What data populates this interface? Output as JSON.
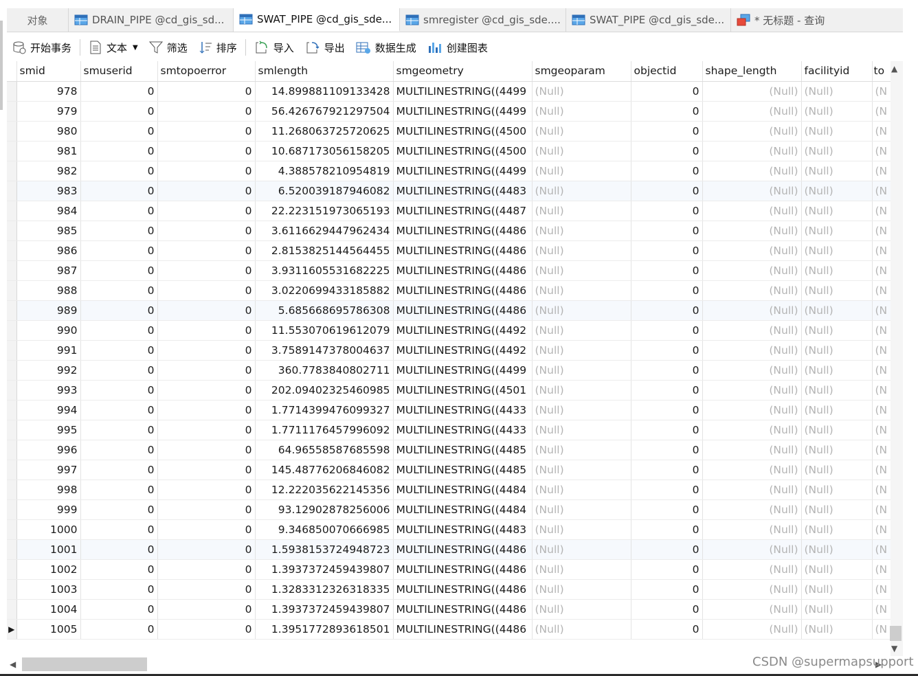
{
  "tabs": [
    {
      "label": "对象"
    },
    {
      "label": "DRAIN_PIPE @cd_gis_sd..."
    },
    {
      "label": "SWAT_PIPE @cd_gis_sde..."
    },
    {
      "label": "smregister @cd_gis_sde...."
    },
    {
      "label": "SWAT_PIPE @cd_gis_sde..."
    },
    {
      "label": "* 无标题 - 查询"
    }
  ],
  "toolbar": {
    "begin_transaction": "开始事务",
    "text": "文本",
    "filter": "筛选",
    "sort": "排序",
    "import": "导入",
    "export": "导出",
    "generate_data": "数据生成",
    "create_chart": "创建图表"
  },
  "columns": [
    "smid",
    "smuserid",
    "smtopoerror",
    "smlength",
    "smgeometry",
    "smgeoparam",
    "objectid",
    "shape_length",
    "facilityid",
    "to"
  ],
  "null_text": "(Null)",
  "null_cut": "(N",
  "rows": [
    {
      "smid": "978",
      "smuserid": "0",
      "smtopoerror": "0",
      "smlength": "14.899881109133428",
      "smgeometry": "MULTILINESTRING((4499",
      "objectid": "0"
    },
    {
      "smid": "979",
      "smuserid": "0",
      "smtopoerror": "0",
      "smlength": "56.426767921297504",
      "smgeometry": "MULTILINESTRING((4499",
      "objectid": "0"
    },
    {
      "smid": "980",
      "smuserid": "0",
      "smtopoerror": "0",
      "smlength": "11.268063725720625",
      "smgeometry": "MULTILINESTRING((4500",
      "objectid": "0"
    },
    {
      "smid": "981",
      "smuserid": "0",
      "smtopoerror": "0",
      "smlength": "10.687173056158205",
      "smgeometry": "MULTILINESTRING((4500",
      "objectid": "0"
    },
    {
      "smid": "982",
      "smuserid": "0",
      "smtopoerror": "0",
      "smlength": "4.388578210954819",
      "smgeometry": "MULTILINESTRING((4499",
      "objectid": "0"
    },
    {
      "smid": "983",
      "smuserid": "0",
      "smtopoerror": "0",
      "smlength": "6.520039187946082",
      "smgeometry": "MULTILINESTRING((4483",
      "objectid": "0"
    },
    {
      "smid": "984",
      "smuserid": "0",
      "smtopoerror": "0",
      "smlength": "22.223151973065193",
      "smgeometry": "MULTILINESTRING((4487",
      "objectid": "0"
    },
    {
      "smid": "985",
      "smuserid": "0",
      "smtopoerror": "0",
      "smlength": "3.6116629447962434",
      "smgeometry": "MULTILINESTRING((4486",
      "objectid": "0"
    },
    {
      "smid": "986",
      "smuserid": "0",
      "smtopoerror": "0",
      "smlength": "2.8153825144564455",
      "smgeometry": "MULTILINESTRING((4486",
      "objectid": "0"
    },
    {
      "smid": "987",
      "smuserid": "0",
      "smtopoerror": "0",
      "smlength": "3.9311605531682225",
      "smgeometry": "MULTILINESTRING((4486",
      "objectid": "0"
    },
    {
      "smid": "988",
      "smuserid": "0",
      "smtopoerror": "0",
      "smlength": "3.0220699433185882",
      "smgeometry": "MULTILINESTRING((4486",
      "objectid": "0"
    },
    {
      "smid": "989",
      "smuserid": "0",
      "smtopoerror": "0",
      "smlength": "5.685668695786308",
      "smgeometry": "MULTILINESTRING((4486",
      "objectid": "0"
    },
    {
      "smid": "990",
      "smuserid": "0",
      "smtopoerror": "0",
      "smlength": "11.553070619612079",
      "smgeometry": "MULTILINESTRING((4492",
      "objectid": "0"
    },
    {
      "smid": "991",
      "smuserid": "0",
      "smtopoerror": "0",
      "smlength": "3.7589147378004637",
      "smgeometry": "MULTILINESTRING((4492",
      "objectid": "0"
    },
    {
      "smid": "992",
      "smuserid": "0",
      "smtopoerror": "0",
      "smlength": "360.7783840802711",
      "smgeometry": "MULTILINESTRING((4499",
      "objectid": "0"
    },
    {
      "smid": "993",
      "smuserid": "0",
      "smtopoerror": "0",
      "smlength": "202.09402325460985",
      "smgeometry": "MULTILINESTRING((4501",
      "objectid": "0"
    },
    {
      "smid": "994",
      "smuserid": "0",
      "smtopoerror": "0",
      "smlength": "1.7714399476099327",
      "smgeometry": "MULTILINESTRING((4433",
      "objectid": "0"
    },
    {
      "smid": "995",
      "smuserid": "0",
      "smtopoerror": "0",
      "smlength": "1.7711176457996092",
      "smgeometry": "MULTILINESTRING((4433",
      "objectid": "0"
    },
    {
      "smid": "996",
      "smuserid": "0",
      "smtopoerror": "0",
      "smlength": "64.96558587685598",
      "smgeometry": "MULTILINESTRING((4485",
      "objectid": "0"
    },
    {
      "smid": "997",
      "smuserid": "0",
      "smtopoerror": "0",
      "smlength": "145.48776206846082",
      "smgeometry": "MULTILINESTRING((4485",
      "objectid": "0"
    },
    {
      "smid": "998",
      "smuserid": "0",
      "smtopoerror": "0",
      "smlength": "12.222035622145356",
      "smgeometry": "MULTILINESTRING((4484",
      "objectid": "0"
    },
    {
      "smid": "999",
      "smuserid": "0",
      "smtopoerror": "0",
      "smlength": "93.12902878256006",
      "smgeometry": "MULTILINESTRING((4484",
      "objectid": "0"
    },
    {
      "smid": "1000",
      "smuserid": "0",
      "smtopoerror": "0",
      "smlength": "9.346850070666985",
      "smgeometry": "MULTILINESTRING((4483",
      "objectid": "0"
    },
    {
      "smid": "1001",
      "smuserid": "0",
      "smtopoerror": "0",
      "smlength": "1.5938153724948723",
      "smgeometry": "MULTILINESTRING((4486",
      "objectid": "0"
    },
    {
      "smid": "1002",
      "smuserid": "0",
      "smtopoerror": "0",
      "smlength": "1.3937372459439807",
      "smgeometry": "MULTILINESTRING((4486",
      "objectid": "0"
    },
    {
      "smid": "1003",
      "smuserid": "0",
      "smtopoerror": "0",
      "smlength": "1.3283312326318335",
      "smgeometry": "MULTILINESTRING((4486",
      "objectid": "0"
    },
    {
      "smid": "1004",
      "smuserid": "0",
      "smtopoerror": "0",
      "smlength": "1.3937372459439807",
      "smgeometry": "MULTILINESTRING((4486",
      "objectid": "0"
    },
    {
      "smid": "1005",
      "smuserid": "0",
      "smtopoerror": "0",
      "smlength": "1.3951772893618501",
      "smgeometry": "MULTILINESTRING((4486",
      "objectid": "0"
    }
  ],
  "current_row_marker": "▶",
  "watermark": "CSDN @supermapsupport",
  "colors": {
    "accent": "#1e73d8",
    "null_text": "#b4b4b4",
    "alt_row": "#f6f9fd"
  }
}
